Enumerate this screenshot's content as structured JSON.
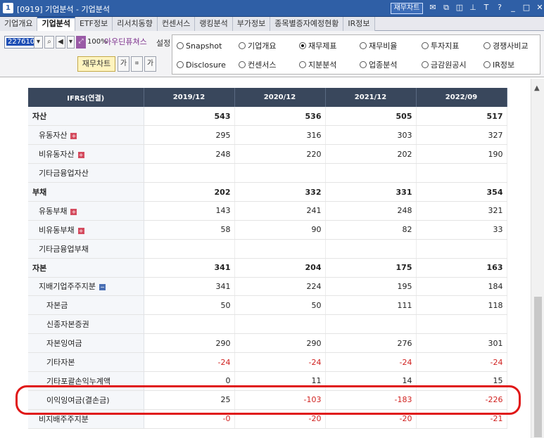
{
  "window": {
    "number_badge": "1",
    "title": "[0919] 기업분석 - 기업분석",
    "fin_chart_label": "재무차트"
  },
  "tabs": [
    {
      "label": "기업개요"
    },
    {
      "label": "기업분석"
    },
    {
      "label": "ETF정보"
    },
    {
      "label": "리서치동향"
    },
    {
      "label": "컨센서스"
    },
    {
      "label": "랭킹분석"
    },
    {
      "label": "부가정보"
    },
    {
      "label": "종목별증자예정현황"
    },
    {
      "label": "IR정보"
    }
  ],
  "toolbar": {
    "code": "227610",
    "zoom": "100%",
    "output_label": "아우딘퓨쳐스",
    "settings_label": "설정",
    "fin_chart_button": "재무차트"
  },
  "radios": [
    {
      "label": "Snapshot",
      "selected": false
    },
    {
      "label": "기업개요",
      "selected": false
    },
    {
      "label": "재무제표",
      "selected": true
    },
    {
      "label": "재무비율",
      "selected": false
    },
    {
      "label": "투자지표",
      "selected": false
    },
    {
      "label": "경쟁사비교",
      "selected": false
    },
    {
      "label": "Disclosure",
      "selected": false
    },
    {
      "label": "컨센서스",
      "selected": false
    },
    {
      "label": "지분분석",
      "selected": false
    },
    {
      "label": "업종분석",
      "selected": false
    },
    {
      "label": "금감원공시",
      "selected": false
    },
    {
      "label": "IR정보",
      "selected": false
    }
  ],
  "table": {
    "headers": [
      "IFRS(연결)",
      "2019/12",
      "2020/12",
      "2021/12",
      "2022/09"
    ],
    "rows": [
      {
        "label": "자산",
        "level": 0,
        "values": [
          "543",
          "536",
          "505",
          "517"
        ]
      },
      {
        "label": "유동자산",
        "level": 1,
        "expand": "plus",
        "values": [
          "295",
          "316",
          "303",
          "327"
        ]
      },
      {
        "label": "비유동자산",
        "level": 1,
        "expand": "plus",
        "values": [
          "248",
          "220",
          "202",
          "190"
        ]
      },
      {
        "label": "기타금융업자산",
        "level": 1,
        "values": [
          "",
          "",
          "",
          ""
        ]
      },
      {
        "label": "부채",
        "level": 0,
        "values": [
          "202",
          "332",
          "331",
          "354"
        ]
      },
      {
        "label": "유동부채",
        "level": 1,
        "expand": "plus",
        "values": [
          "143",
          "241",
          "248",
          "321"
        ]
      },
      {
        "label": "비유동부채",
        "level": 1,
        "expand": "plus",
        "values": [
          "58",
          "90",
          "82",
          "33"
        ]
      },
      {
        "label": "기타금융업부채",
        "level": 1,
        "values": [
          "",
          "",
          "",
          ""
        ]
      },
      {
        "label": "자본",
        "level": 0,
        "values": [
          "341",
          "204",
          "175",
          "163"
        ]
      },
      {
        "label": "지배기업주주지분",
        "level": 1,
        "expand": "minus",
        "values": [
          "341",
          "224",
          "195",
          "184"
        ]
      },
      {
        "label": "자본금",
        "level": 2,
        "values": [
          "50",
          "50",
          "111",
          "118"
        ]
      },
      {
        "label": "신종자본증권",
        "level": 2,
        "values": [
          "",
          "",
          "",
          ""
        ]
      },
      {
        "label": "자본잉여금",
        "level": 2,
        "values": [
          "290",
          "290",
          "276",
          "301"
        ]
      },
      {
        "label": "기타자본",
        "level": 2,
        "values": [
          "-24",
          "-24",
          "-24",
          "-24"
        ]
      },
      {
        "label": "기타포괄손익누계액",
        "level": 2,
        "values": [
          "0",
          "11",
          "14",
          "15"
        ]
      },
      {
        "label": "이익잉여금(결손금)",
        "level": 2,
        "values": [
          "25",
          "-103",
          "-183",
          "-226"
        ]
      },
      {
        "label": "비지배주주지분",
        "level": 1,
        "values": [
          "-0",
          "-20",
          "-20",
          "-21"
        ]
      }
    ]
  },
  "colors": {
    "titlebar": "#2f5fa6",
    "table_header": "#39475c",
    "negative": "#d0211f",
    "highlight": "#e01717"
  }
}
